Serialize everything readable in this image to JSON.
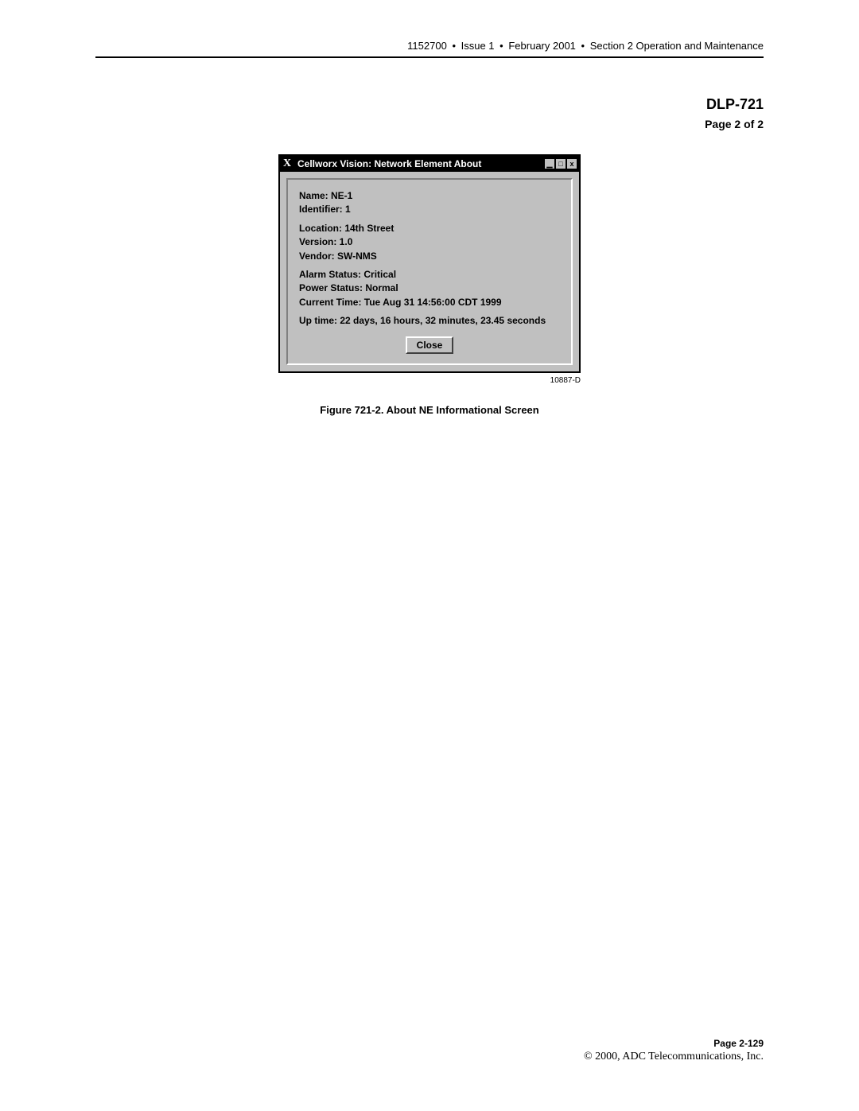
{
  "header": {
    "doc_no": "1152700",
    "issue": "Issue 1",
    "date": "February 2001",
    "section": "Section 2 Operation and Maintenance"
  },
  "dlp": {
    "title": "DLP-721",
    "page": "Page 2 of 2"
  },
  "window": {
    "title": "Cellworx Vision: Network Element About",
    "fields": {
      "name": "Name: NE-1",
      "identifier": "Identifier:  1",
      "location": "Location:  14th Street",
      "version": "Version: 1.0",
      "vendor": "Vendor: SW-NMS",
      "alarm": "Alarm Status: Critical",
      "power": "Power Status:  Normal",
      "time": "Current Time: Tue Aug 31 14:56:00 CDT 1999",
      "uptime": "Up time: 22 days, 16 hours, 32 minutes, 23.45 seconds"
    },
    "close": "Close"
  },
  "figure": {
    "id": "10887-D",
    "caption": "Figure 721-2.  About NE Informational Screen"
  },
  "footer": {
    "page": "Page 2-129",
    "copyright": "© 2000, ADC Telecommunications, Inc."
  }
}
